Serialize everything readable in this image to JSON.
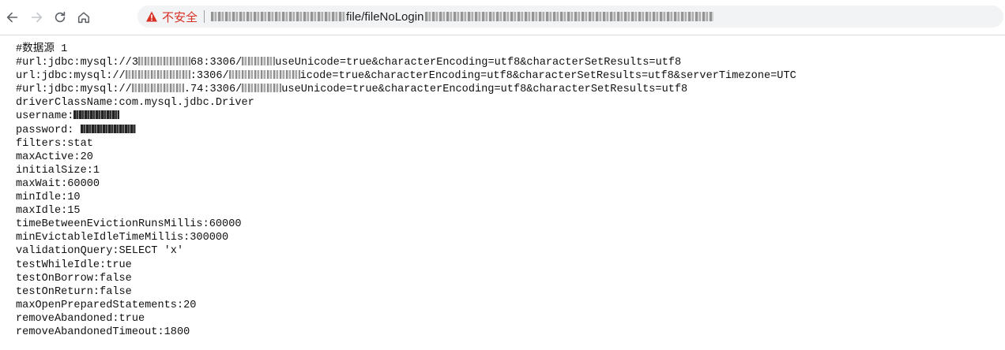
{
  "browser": {
    "security_label": "不安全",
    "url_path": "file/fileNoLogin",
    "icons": {
      "back": "arrow-left-icon",
      "forward": "arrow-right-icon",
      "reload": "reload-icon",
      "home": "home-icon",
      "warning": "warning-triangle-icon"
    },
    "warning_color": "#d93025"
  },
  "content": {
    "l1": "#数据源 1",
    "l2a": "#url:jdbc:mysql://3",
    "l2b": "68:3306/",
    "l2c": "useUnicode=true&characterEncoding=utf8&characterSetResults=utf8",
    "l3a": "url:jdbc:mysql://",
    "l3b": ":3306/",
    "l3c": "icode=true&characterEncoding=utf8&characterSetResults=utf8&serverTimezone=UTC",
    "l4a": "#url:jdbc:mysql://",
    "l4b": ".74:3306/",
    "l4c": "useUnicode=true&characterEncoding=utf8&characterSetResults=utf8",
    "l5": "driverClassName:com.mysql.jdbc.Driver",
    "l6": "username:",
    "l7": "password: ",
    "l8": "filters:stat",
    "l9": "maxActive:20",
    "l10": "initialSize:1",
    "l11": "maxWait:60000",
    "l12": "minIdle:10",
    "l13": "maxIdle:15",
    "l14": "timeBetweenEvictionRunsMillis:60000",
    "l15": "minEvictableIdleTimeMillis:300000",
    "l16": "validationQuery:SELECT 'x'",
    "l17": "testWhileIdle:true",
    "l18": "testOnBorrow:false",
    "l19": "testOnReturn:false",
    "l20": "maxOpenPreparedStatements:20",
    "l21": "removeAbandoned:true",
    "l22": "removeAbandonedTimeout:1800"
  }
}
